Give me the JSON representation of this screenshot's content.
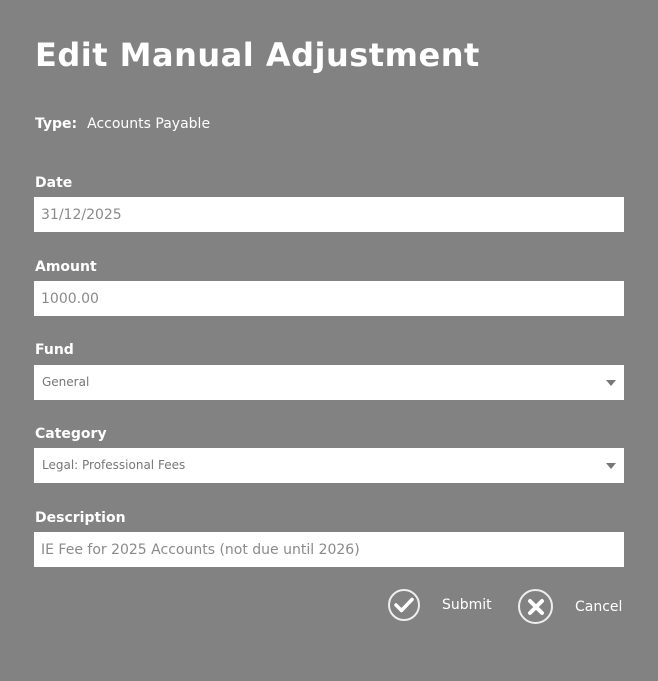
{
  "title": "Edit Manual Adjustment",
  "type": {
    "label": "Type:",
    "value": "Accounts Payable"
  },
  "date": {
    "label": "Date",
    "value": "31/12/2025"
  },
  "amount": {
    "label": "Amount",
    "value": "1000.00"
  },
  "fund": {
    "label": "Fund",
    "value": "General"
  },
  "category": {
    "label": "Category",
    "value": "Legal: Professional Fees"
  },
  "description": {
    "label": "Description",
    "value": "IE Fee for 2025 Accounts (not due until 2026)"
  },
  "actions": {
    "submit": "Submit",
    "cancel": "Cancel"
  }
}
